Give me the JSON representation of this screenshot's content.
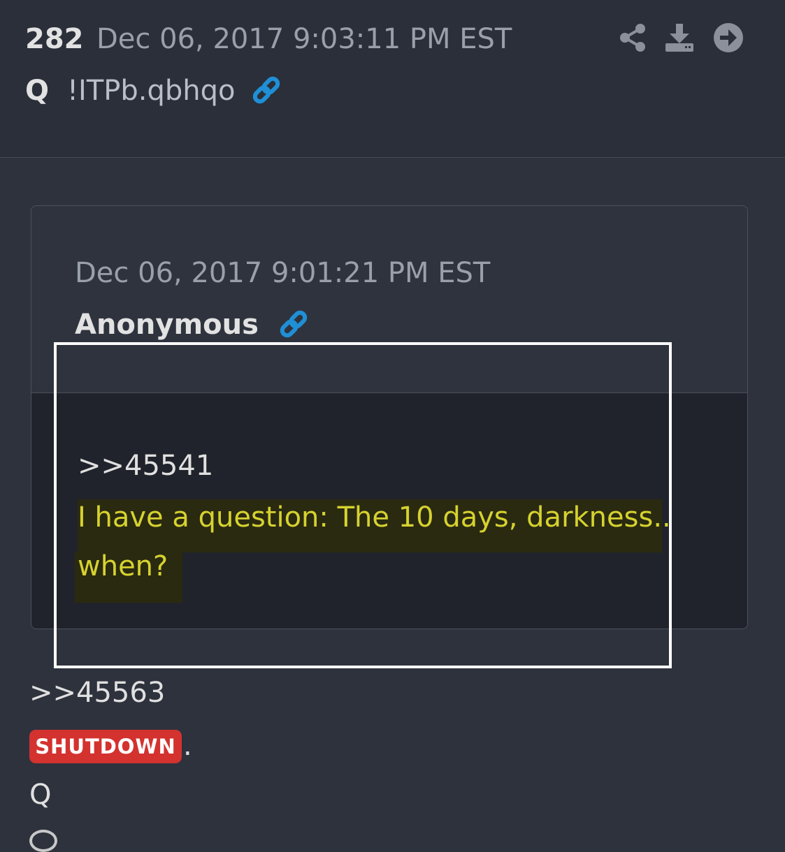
{
  "post": {
    "number": "282",
    "timestamp": "Dec 06, 2017 9:03:11 PM EST",
    "author": "Q",
    "tripcode": "!ITPb.qbhqo"
  },
  "header_icons": [
    "share-icon",
    "download-icon",
    "arrow-right-icon",
    "link-icon"
  ],
  "quoted_post": {
    "timestamp": "Dec 06, 2017 9:01:21 PM EST",
    "author": "Anonymous",
    "reference": ">>45541",
    "line1": "I have a question: The 10 days, darkness..",
    "line2": "when?"
  },
  "reply": {
    "reference": ">>45563",
    "badge": "SHUTDOWN",
    "after_badge": ".",
    "signature": "Q"
  },
  "colors": {
    "page_bg": "#2e323d",
    "header_bg": "#2b2f39",
    "card_body_bg": "#20232b",
    "highlight_text": "#d6d230",
    "highlight_bg": "#2a2a10",
    "link_blue": "#1f8fd6",
    "badge_red": "#d3322f"
  }
}
